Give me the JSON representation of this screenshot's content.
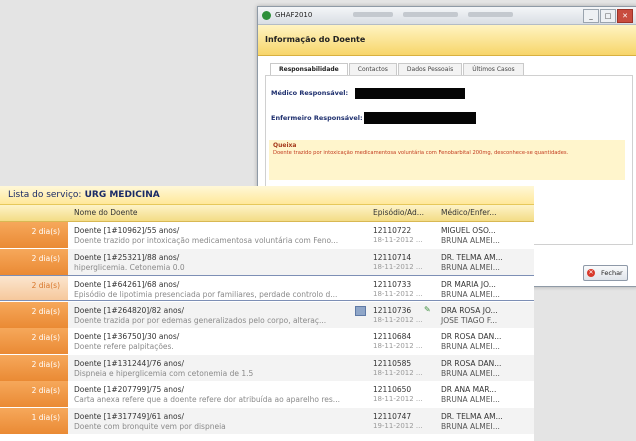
{
  "detail_window": {
    "title": "GHAF2010",
    "header": "Informação do Doente",
    "tabs": [
      "Responsabilidade",
      "Contactos",
      "Dados Pessoais",
      "Últimos Casos"
    ],
    "medico_label": "Médico Responsável:",
    "enfermeiro_label": "Enfermeiro Responsável:",
    "queixa_label": "Queixa",
    "queixa_text": "Doente trazido por intoxicação medicamentosa voluntária com Fenobarbital 200mg, desconhece-se quantidades.",
    "close_button": "Fechar",
    "window_buttons": [
      "_",
      "□",
      "✕"
    ]
  },
  "service_list": {
    "title_label": "Lista do serviço:",
    "title_value": "URG MEDICINA",
    "columns": [
      "Nome do Doente",
      "Episódio/Ad...",
      "Médico/Enfer..."
    ],
    "rows": [
      {
        "days": "2 dia(s)",
        "name": "Doente [1#10962]/55 anos/",
        "complaint": "Doente trazido por intoxicação medicamentosa voluntária com Feno...",
        "episode": "12110722",
        "date": "18-11-2012 ...",
        "doctor": "MIGUEL OSO...",
        "nurse": "BRUNA ALMEI...",
        "selected": false
      },
      {
        "days": "2 dia(s)",
        "name": "Doente [1#25321]/88 anos/",
        "complaint": "hiperglicemia. Cetonemia 0.0",
        "episode": "12110714",
        "date": "18-11-2012 ...",
        "doctor": "DR. TELMA AM...",
        "nurse": "BRUNA ALMEI...",
        "selected": false
      },
      {
        "days": "2 dia(s)",
        "name": "Doente [1#64261]/68 anos/",
        "complaint": "Episódio de lipotimia presenciada por familiares, perdade controlo d...",
        "episode": "12110733",
        "date": "18-11-2012 ...",
        "doctor": "DR MARIA JO...",
        "nurse": "BRUNA ALMEI...",
        "selected": true
      },
      {
        "days": "2 dia(s)",
        "name": "Doente [1#264820]/82 anos/",
        "complaint": "Doente trazida por por edemas generalizados pelo corpo, alteraç...",
        "episode": "12110736",
        "date": "18-11-2012 ...",
        "doctor": "DRA ROSA JO...",
        "nurse": "JOSE TIAGO F...",
        "selected": false
      },
      {
        "days": "2 dia(s)",
        "name": "Doente [1#36750]/30 anos/",
        "complaint": "Doente refere palpitações.",
        "episode": "12110684",
        "date": "18-11-2012 ...",
        "doctor": "DR ROSA DAN...",
        "nurse": "BRUNA ALMEI...",
        "selected": false
      },
      {
        "days": "2 dia(s)",
        "name": "Doente [1#131244]/76 anos/",
        "complaint": "Dispneia e hiperglicemia com cetonemia de 1.5",
        "episode": "12110585",
        "date": "18-11-2012 ...",
        "doctor": "DR ROSA DAN...",
        "nurse": "BRUNA ALMEI...",
        "selected": false
      },
      {
        "days": "2 dia(s)",
        "name": "Doente [1#207799]/75 anos/",
        "complaint": "Carta anexa refere que a doente refere dor atribuída ao aparelho res...",
        "episode": "12110650",
        "date": "18-11-2012 ...",
        "doctor": "DR ANA MAR...",
        "nurse": "BRUNA ALMEI...",
        "selected": false
      },
      {
        "days": "1 dia(s)",
        "name": "Doente [1#317749]/61 anos/",
        "complaint": "Doente com bronquite vem por dispneia",
        "episode": "12110747",
        "date": "19-11-2012 ...",
        "doctor": "DR. TELMA AM...",
        "nurse": "BRUNA ALMEI...",
        "selected": false
      }
    ]
  }
}
